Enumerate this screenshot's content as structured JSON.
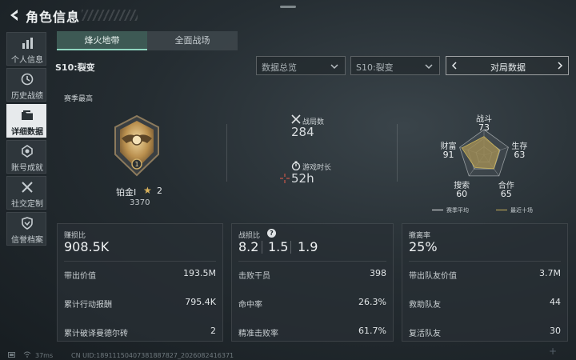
{
  "header": {
    "title": "角色信息"
  },
  "sidebar": {
    "items": [
      {
        "label": "个人信息",
        "icon": "bar-chart-icon"
      },
      {
        "label": "历史战绩",
        "icon": "history-icon"
      },
      {
        "label": "详细数据",
        "icon": "folder-icon",
        "active": true
      },
      {
        "label": "账号成就",
        "icon": "medal-icon"
      },
      {
        "label": "社交定制",
        "icon": "tools-icon"
      },
      {
        "label": "信誉档案",
        "icon": "shield-icon"
      }
    ]
  },
  "mode_tabs": [
    {
      "label": "烽火地带",
      "active": true
    },
    {
      "label": "全面战场",
      "active": false
    }
  ],
  "season_label": "S10:裂变",
  "filters": {
    "data_dropdown": "数据总览",
    "season_dropdown": "S10:裂变",
    "match_nav": "对局数据"
  },
  "best_section": {
    "label": "赛季最高",
    "rank_name": "铂金I",
    "rank_stars": "2",
    "rank_score": "3370",
    "badge_number": "1"
  },
  "summary": {
    "matches_label": "战局数",
    "matches_value": "284",
    "playtime_label": "游戏时长",
    "playtime_value": "52h"
  },
  "radar": {
    "axes": [
      {
        "label": "战斗",
        "value": 73
      },
      {
        "label": "生存",
        "value": 63
      },
      {
        "label": "合作",
        "value": 65
      },
      {
        "label": "搜索",
        "value": 60
      },
      {
        "label": "财富",
        "value": 91
      }
    ],
    "legend": [
      {
        "label": "赛季平均",
        "color": "#e6e9eb"
      },
      {
        "label": "最近十场",
        "color": "#c8b25a"
      }
    ],
    "fill_color": "#9b8a55"
  },
  "panels": [
    {
      "title": "赚损比",
      "value": "908.5K",
      "rows": [
        {
          "label": "带出价值",
          "value": "193.5M"
        },
        {
          "label": "累计行动报酬",
          "value": "795.4K"
        },
        {
          "label": "累计破译曼德尔砖",
          "value": "2"
        }
      ]
    },
    {
      "title": "战损比",
      "help": "?",
      "values": [
        "8.2",
        "1.5",
        "1.9"
      ],
      "rows": [
        {
          "label": "击败干员",
          "value": "398"
        },
        {
          "label": "命中率",
          "value": "26.3%"
        },
        {
          "label": "精准击败率",
          "value": "61.7%"
        }
      ]
    },
    {
      "title": "撤离率",
      "value": "25%",
      "rows": [
        {
          "label": "带出队友价值",
          "value": "3.7M"
        },
        {
          "label": "救助队友",
          "value": "44"
        },
        {
          "label": "复活队友",
          "value": "30"
        }
      ]
    }
  ],
  "status_bar": {
    "ping": "37ms",
    "uid": "CN UID:18911150407381887827_2026082416371"
  }
}
